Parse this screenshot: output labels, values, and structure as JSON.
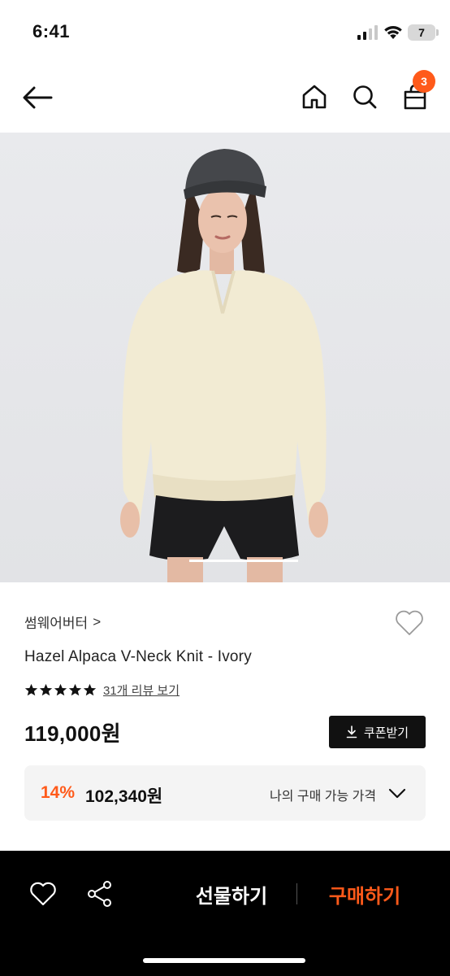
{
  "status_bar": {
    "time": "6:41",
    "battery": "7"
  },
  "nav": {
    "cart_count": "3",
    "icons": [
      "back-arrow-icon",
      "home-icon",
      "search-icon",
      "shopping-bag-icon"
    ]
  },
  "hero": {
    "image": "model wearing ivory alpaca v-neck knit with black shorts and grey newsboy cap"
  },
  "product": {
    "brand": "썸웨어버터",
    "brand_chevron": ">",
    "name": "Hazel Alpaca V-Neck Knit - Ivory",
    "rating_stars": 5,
    "review_link": "31개 리뷰 보기",
    "price": "119,000원",
    "coupon_label": "쿠폰받기"
  },
  "best_price": {
    "discount_rate": "14%",
    "price": "102,340원",
    "label": "나의 구매 가능 가격"
  },
  "bottom_bar": {
    "gift_label": "선물하기",
    "buy_label": "구매하기"
  },
  "colors": {
    "accent": "#ff5a1a",
    "dark": "#111111",
    "panel": "#f4f4f4"
  }
}
